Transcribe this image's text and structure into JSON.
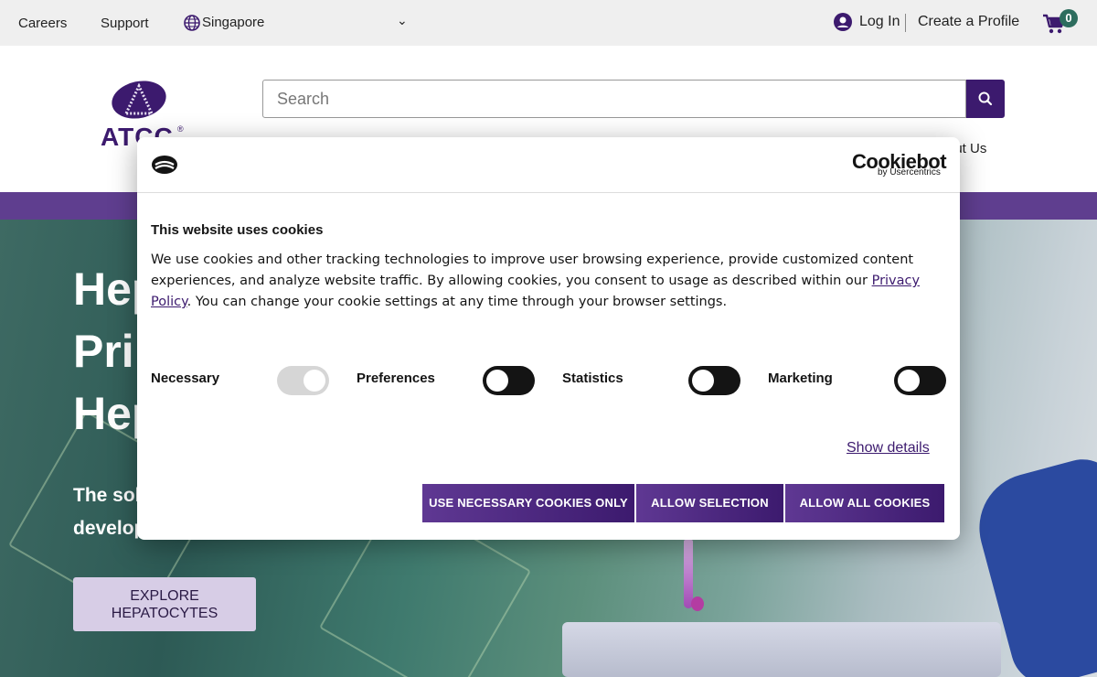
{
  "topbar": {
    "careers": "Careers",
    "support": "Support",
    "region": "Singapore",
    "login": "Log In",
    "create_profile": "Create a Profile",
    "cart_count": "0"
  },
  "header": {
    "logo_text": "ATCC",
    "search_placeholder": "Search",
    "nav_partial": "out Us"
  },
  "hero": {
    "title_lines": [
      "Hep",
      "Prim",
      "Hep"
    ],
    "subtitle_lines": [
      "The solu",
      "develop"
    ],
    "cta_line1": "EXPLORE",
    "cta_line2": "HEPATOCYTES"
  },
  "cookie_dialog": {
    "brand": "Cookiebot",
    "brand_sub": "by Usercentrics",
    "title": "This website uses cookies",
    "body_part1": "We use cookies and other tracking technologies to improve user browsing experience, provide customized content experiences, and analyze website traffic. By allowing cookies, you consent to usage as described within our ",
    "privacy_link": "Privacy Policy",
    "body_part2": ". You can change your cookie settings at any time through your browser settings.",
    "categories": [
      {
        "label": "Necessary",
        "enabled": true,
        "locked": true
      },
      {
        "label": "Preferences",
        "enabled": false
      },
      {
        "label": "Statistics",
        "enabled": false
      },
      {
        "label": "Marketing",
        "enabled": false
      }
    ],
    "show_details": "Show details",
    "buttons": {
      "necessary_only": "USE NECESSARY COOKIES ONLY",
      "allow_selection": "ALLOW SELECTION",
      "allow_all": "ALLOW ALL COOKIES"
    }
  },
  "colors": {
    "brand_purple": "#3c1a6e",
    "band_purple": "#5f3e8f",
    "cart_badge": "#2d6d5e"
  }
}
